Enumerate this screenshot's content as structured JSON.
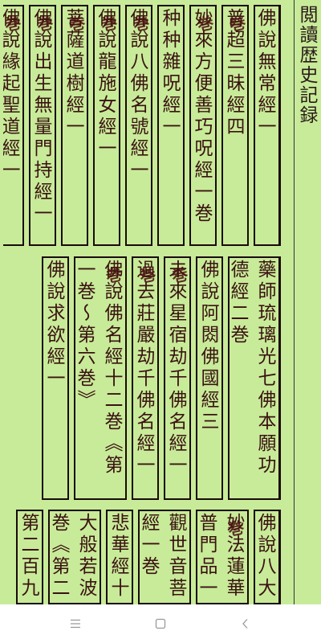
{
  "title": "閲讀歴史記録",
  "stamp": "巻",
  "blocks": [
    [
      {
        "text": "佛說無常經一",
        "w": 1
      },
      {
        "text": "普超三昧經四",
        "w": 1,
        "stamp": true
      },
      {
        "text": "妙來方便善巧呪經一巻",
        "w": 1,
        "stamp": true
      },
      {
        "text": "种种雜呪經一",
        "w": 1
      },
      {
        "text": "佛說八佛名號經一",
        "w": 1,
        "stamp": true
      },
      {
        "text": "佛說龍施女經一",
        "w": 1,
        "stamp": true
      },
      {
        "text": "菩薩道樹經一",
        "w": 1,
        "stamp": true
      },
      {
        "text": "佛說出生無量門持經一",
        "w": 1,
        "stamp": true
      },
      {
        "text": "佛說緣起聖道經一",
        "w": 1,
        "stamp": true
      }
    ],
    [
      {
        "text": "藥師琉璃光七佛本願功德經二巻",
        "w": 2
      },
      {
        "text": "佛說阿閦佛國經三",
        "w": 1
      },
      {
        "text": "未來星宿劫千佛名經一",
        "w": 1,
        "stamp": true
      },
      {
        "text": "過去莊嚴劫千佛名經一",
        "w": 1,
        "stamp": true
      },
      {
        "text": "佛說佛名經十二巻《第一巻～第六巻》",
        "w": 2,
        "stamp": true
      },
      {
        "text": "佛說求欲經一",
        "w": 1
      }
    ],
    [
      {
        "text": "佛說八大",
        "w": 1
      },
      {
        "text": "妙法蓮華普門品一",
        "w": 2,
        "stamp": true
      },
      {
        "text": "觀世音菩經一巻",
        "w": 2
      },
      {
        "text": "悲華經十",
        "w": 1
      },
      {
        "text": "大般若波巻《第二三",
        "w": 2
      },
      {
        "text": "第二百九",
        "w": 1
      }
    ]
  ],
  "nav": {
    "menu_icon": "menu-lines-icon",
    "home_icon": "square-home-icon",
    "back_icon": "chevron-left-back-icon"
  }
}
